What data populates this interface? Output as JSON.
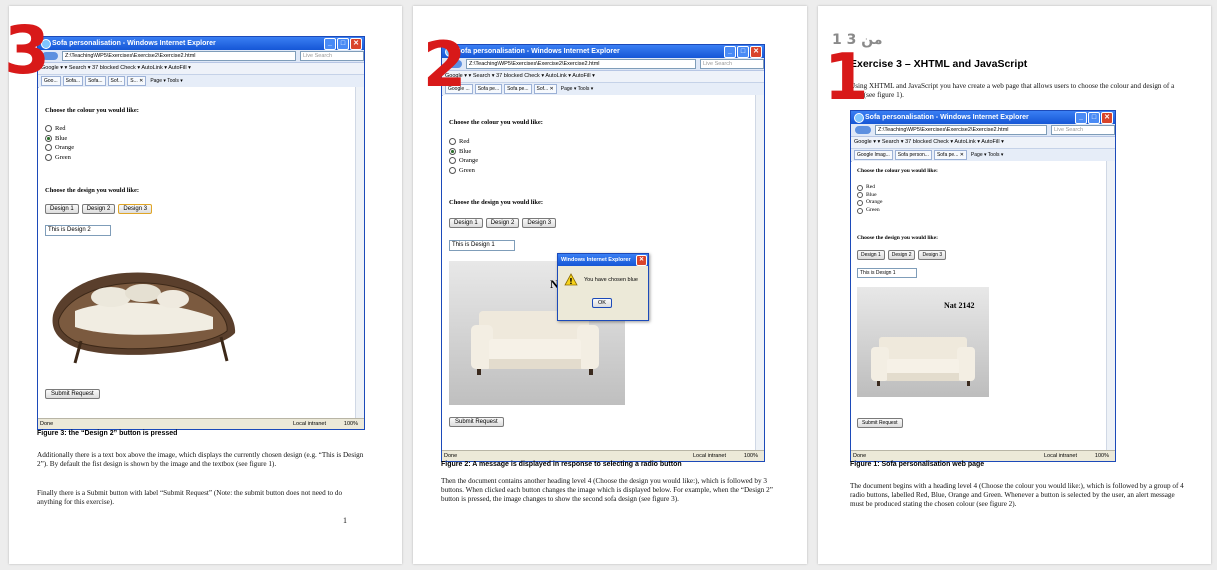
{
  "ie": {
    "window_title": "Sofa personalisation - Windows Internet Explorer",
    "address": "Z:\\Teaching\\WP5\\Exercises\\Exercise2\\Exercise2.html",
    "search_placeholder": "Live Search",
    "google_bar": "Google  ▾          ▾  Search ▾   37 blocked   Check ▾   AutoLink ▾   AutoFill ▾",
    "tabs_p1": [
      "Goo...",
      "Sofa...",
      "Sofa...",
      "Sof...",
      "S... ✕"
    ],
    "tabs_p2": [
      "Google ...",
      "Sofa pe...",
      "Sofa pe...",
      "Sof... ✕"
    ],
    "tabs_p3": [
      "Google Imag...",
      "Sofa person...",
      "Sofa pe... ✕"
    ],
    "toolbar_right": "Page ▾  Tools ▾",
    "status_done": "Done",
    "status_zone": "Local intranet",
    "status_zoom": "100%",
    "heading_colour": "Choose the colour you would like:",
    "colours": [
      "Red",
      "Blue",
      "Orange",
      "Green"
    ],
    "heading_design": "Choose the design you would like:",
    "design_buttons": [
      "Design 1",
      "Design 2",
      "Design 3"
    ],
    "submit_label": "Submit Request",
    "image_label_nat": "Nat 2142",
    "image_label_partial": "N"
  },
  "page1": {
    "annotation": "3",
    "design_text": "This is Design 2",
    "caption": "Figure 3: the “Design 2” button is pressed",
    "para1": "Additionally there is a text box above the image, which displays the currently chosen design (e.g. “This is Design 2”).  By default the fist design is shown by the image and the textbox (see figure 1).",
    "para2": "Finally there is a Submit button with label “Submit Request” (Note: the submit button does not need to do anything for this exercise).",
    "page_number": "1"
  },
  "page2": {
    "annotation": "2",
    "design_text": "This is Design 1",
    "dialog_title": "Windows Internet Explorer",
    "dialog_message": "You have chosen blue",
    "dialog_ok": "OK",
    "caption": "Figure 2: A message is displayed in response to selecting a radio button",
    "para": "Then the document contains another heading level 4 (Choose the design you would like:), which is followed by 3 buttons. When clicked each button changes the image which is displayed below.  For example, when the “Design 2” button is pressed, the image changes to show the second sofa design (see figure 3)."
  },
  "page3": {
    "annotation": "1",
    "page_counter": "1 من 3",
    "title": "Exercise 3 – XHTML and JavaScript",
    "intro": "Using XHTML and JavaScript you have create a web page that allows users to choose the colour and design of a sofa (see figure 1).",
    "design_text": "This is Design 1",
    "caption": "Figure 1: Sofa personalisation web page",
    "para": "The document begins with a heading level 4 (Choose the colour you would like:), which is followed by a group of 4 radio buttons, labelled Red, Blue, Orange and Green.  Whenever a button is selected by the user, an alert message must be produced stating the chosen colour (see figure 2)."
  }
}
